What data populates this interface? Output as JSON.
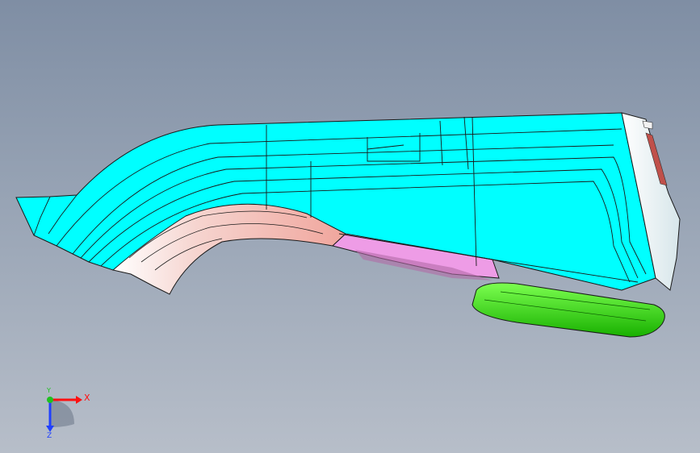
{
  "viewport": {
    "background_top": "#7f8ea4",
    "background_bottom": "#b7bec9"
  },
  "model": {
    "colors": {
      "main_body": "#00ffff",
      "lower_trim": "#f2c2bd",
      "accent_strip": "#ee9ce6",
      "bottom_pad": "#33ee11",
      "edge_lines": "#1a1a1a"
    }
  },
  "triad": {
    "x_label": "X",
    "y_label": "Y",
    "z_label": "Z",
    "x_color": "#ff1010",
    "y_color": "#20c020",
    "z_color": "#2040ff"
  }
}
